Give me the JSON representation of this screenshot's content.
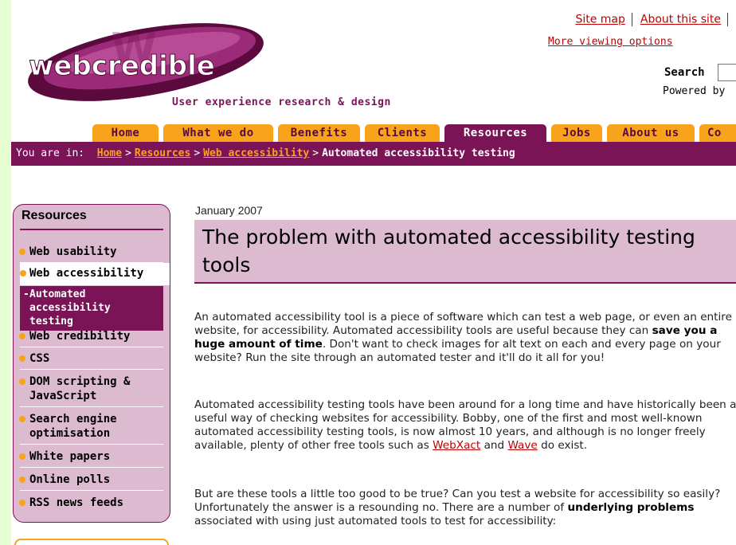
{
  "header": {
    "logo_text": "webcredible",
    "tagline": "User experience research & design",
    "links": [
      "Site map",
      "About this site"
    ],
    "more_viewing": "More viewing options",
    "search_label": "Search",
    "powered_by": "Powered by"
  },
  "nav": {
    "tabs": [
      "Home",
      "What we do",
      "Benefits",
      "Clients",
      "Resources",
      "Jobs",
      "About us",
      "Co"
    ],
    "active": "Resources"
  },
  "breadcrumb": {
    "prefix": "You are in:",
    "links": [
      "Home",
      "Resources",
      "Web accessibility"
    ],
    "current": "Automated accessibility testing",
    "separator": ">"
  },
  "sidebar": {
    "title": "Resources",
    "items": [
      "Web usability",
      "Web accessibility",
      "Automated accessibility testing",
      "Web credibility",
      "CSS",
      "DOM scripting & JavaScript",
      "Search engine optimisation",
      "White papers",
      "Online polls",
      "RSS news feeds"
    ]
  },
  "article": {
    "date": "January 2007",
    "title": "The problem with automated accessibility testing tools",
    "p1_a": "An automated accessibility tool is a piece of software which can test a web page, or even an entire website, for accessibility. Automated accessibility tools are useful because they can ",
    "p1_b": "save you a huge amount of time",
    "p1_c": ". Don't want to check images for alt text on each and every page on your website? Run the site through an automated tester and it'll do it all for you!",
    "p2_a": "Automated accessibility testing tools have been around for a long time and have historically been a useful way of checking websites for accessibility. Bobby, one of the first and most well-known automated accessibility testing tools, is now almost 10 years, and although is no longer freely available, plenty of other free tools such as ",
    "p2_link1": "WebXact",
    "p2_and": " and ",
    "p2_link2": "Wave",
    "p2_c": " do exist.",
    "p3_a": "But are these tools a little too good to be true? Can you test a website for accessibility so easily? Unfortunately the answer is a resounding no. There are a number of ",
    "p3_b": "underlying problems",
    "p3_c": " associated with using just automated tools to test for accessibility:"
  },
  "colors": {
    "brand_purple": "#7a1457",
    "accent_orange": "#f7a31c",
    "light_purple": "#dcbad0",
    "link_red": "#c00000",
    "frame_green": "#e6ffd2"
  }
}
